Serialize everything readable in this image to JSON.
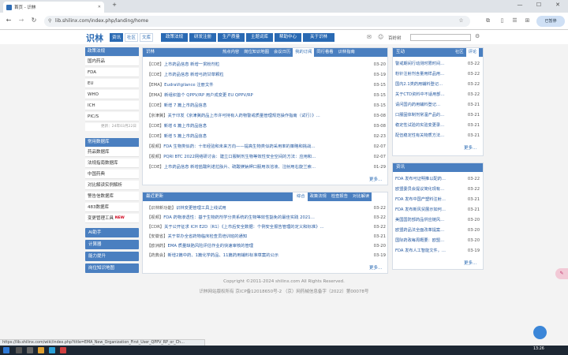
{
  "browser": {
    "tab_title": "首页 - 识林",
    "new_tab": "+",
    "url": "lib.shilinx.com/index.php/landing/home",
    "profile_label": "已暂停",
    "min": "—",
    "max": "☐",
    "close": "✕",
    "back": "←",
    "refresh": "↻"
  },
  "site": {
    "logo": "识林",
    "header_tabs": [
      "资讯",
      "社区",
      "文库"
    ],
    "nav": [
      "政策法规",
      "研发注册",
      "生产质量",
      "主题词库",
      "帮助中心",
      "关于识林"
    ],
    "user_label": "百岭树"
  },
  "left": {
    "group1_title": "政策法规",
    "group1_items": [
      "国内药品",
      "FDA",
      "EU",
      "WHO",
      "ICH",
      "PIC/S"
    ],
    "updated_note": "更新：24年03月22日",
    "group2_title": "常用数据库",
    "group2_items": [
      "药品数据库",
      "法规指南数据库",
      "中国药典",
      "对比解读实例解析",
      "警告信数据库",
      "483数据库",
      "变更管理工具"
    ],
    "new_badge": "NEW",
    "buttons": [
      "AI助手",
      "计算器",
      "能力提升",
      "岗位知识地图"
    ]
  },
  "main": {
    "header": "识林",
    "tabs": [
      "热点内容",
      "岗位知识地图",
      "会议日历",
      "我的订阅",
      "同行看看",
      "识林指南"
    ],
    "rows": [
      {
        "tag": "【CDE】",
        "text": "上市药品信息 新增一贯粉剂粒",
        "date": "03-20"
      },
      {
        "tag": "【CDE】",
        "text": "上市药品信息 新增弓药甘草颗粒",
        "date": "03-19"
      },
      {
        "tag": "【EMA】",
        "text": "EudraVigilance 注册文件",
        "date": "03-15"
      },
      {
        "tag": "【EMA】",
        "text": "新组织首个 QPPV/RP 用户成变更 EU QPPV/RP",
        "date": "03-15"
      },
      {
        "tag": "【CDE】",
        "text": "新增 7 篇上市药品信息",
        "date": "03-15"
      },
      {
        "tag": "【京津冀】",
        "text": "关于印发《京津冀药品上市许可持有人药物警戒质量管理规范操作指南（试行）》…",
        "date": "03-08"
      },
      {
        "tag": "【CDE】",
        "text": "新增 6 篇上市药品信息",
        "date": "03-08"
      },
      {
        "tag": "【CDE】",
        "text": "新增 5 篇上市药品信息",
        "date": "02-23"
      },
      {
        "tag": "【视频】",
        "text": "FDA 生物类似药：十年经验和未来方向——提高生物类似药采用率的策略和挑战…",
        "date": "02-07"
      },
      {
        "tag": "【视频】",
        "text": "PQRI BTC 2022网络研讨会：建立口服制剂生物等效性安全空间的方法：应用和…",
        "date": "02-07"
      },
      {
        "tag": "【CDE】",
        "text": "上市药品信息 新增盐酸利诺拉肽片、硫酸镁钠钾口服用浓溶液、注射用右旋兰索…",
        "date": "01-29"
      }
    ],
    "more": "更多..."
  },
  "recent": {
    "header": "最近更新",
    "tabs": [
      "综合",
      "政策法规",
      "检查报告",
      "对比解读"
    ],
    "rows": [
      {
        "tag": "【识林新功能】",
        "text": "识林变更管理工具上线试用",
        "date": "03-22"
      },
      {
        "tag": "【视频】",
        "text": "FDA 药物渗透性：基于生物药剂学分类系统的生物等效性豁免的最佳实践 2021…",
        "date": "03-22"
      },
      {
        "tag": "【CDR】",
        "text": "关于公开征求 ICH E2D（R1）《上市后安全数据：个例安全报告管理的定义和标准》…",
        "date": "03-22"
      },
      {
        "tag": "【安徽省】",
        "text": "关于举办全省药物临床检查员培训班的通知",
        "date": "03-21"
      },
      {
        "tag": "【欧洲药】",
        "text": "EMA 质量缺陷风险评估作业的快速审核的管理",
        "date": "03-20"
      },
      {
        "tag": "【药典会】",
        "text": "新增2篇中药、1篇化学药品、11篇药用辅料标准草案的公示",
        "date": "03-19"
      }
    ],
    "more": "更多..."
  },
  "hudong": {
    "header": "互动",
    "tabs": [
      "社区",
      "评论"
    ],
    "rows": [
      {
        "text": "警戒期间行动测时限时间…",
        "date": "03-22"
      },
      {
        "text": "粉针注射剂含量用样品用…",
        "date": "03-22"
      },
      {
        "text": "国内2.1类药用辅料登记…",
        "date": "03-22"
      },
      {
        "text": "关于CTD资料中不适用部…",
        "date": "03-22"
      },
      {
        "text": "请问国内药用辅料登记…",
        "date": "03-21"
      },
      {
        "text": "口服固体制剂常温产品的…",
        "date": "03-21"
      },
      {
        "text": "稳定性试验的实验变更录…",
        "date": "03-21"
      },
      {
        "text": "配伍稳定性有关物质方法…",
        "date": "03-21"
      }
    ],
    "more": "更多..."
  },
  "zixun": {
    "header": "资讯",
    "rows": [
      {
        "text": "FDA 发布可证明推以配药…",
        "date": "03-22"
      },
      {
        "text": "欧盟委员会提议简化现有…",
        "date": "03-22"
      },
      {
        "text": "FDA 发布中国产塑料注射…",
        "date": "03-21"
      },
      {
        "text": "FDA 发布新风贸展示如何…",
        "date": "03-21"
      },
      {
        "text": "美国国防部药品供应链风…",
        "date": "03-20"
      },
      {
        "text": "欧盟药品法全面改革提案…",
        "date": "03-20"
      },
      {
        "text": "国际药政每周概要：欧盟…",
        "date": "03-20"
      },
      {
        "text": "FDA 发布人工智能文件，…",
        "date": "03-19"
      }
    ],
    "more": "更多..."
  },
  "footer": {
    "copyright": "Copyright ©2011-2024 shilinx.com All Rights Reserved.",
    "icp": "识林网站版权所有 京ICP备12018650号-2 （京）网药械信息备字（2022）第00078号"
  },
  "status_url": "https://lib.shilinx.com/wiki/index.php?title=EMA_New_Organization_First_User_QPPV_RP_or_Ch…",
  "clock": "13:26",
  "colors": {
    "accent": "#2a6ab3",
    "panel_head": "#4a7fc0"
  }
}
